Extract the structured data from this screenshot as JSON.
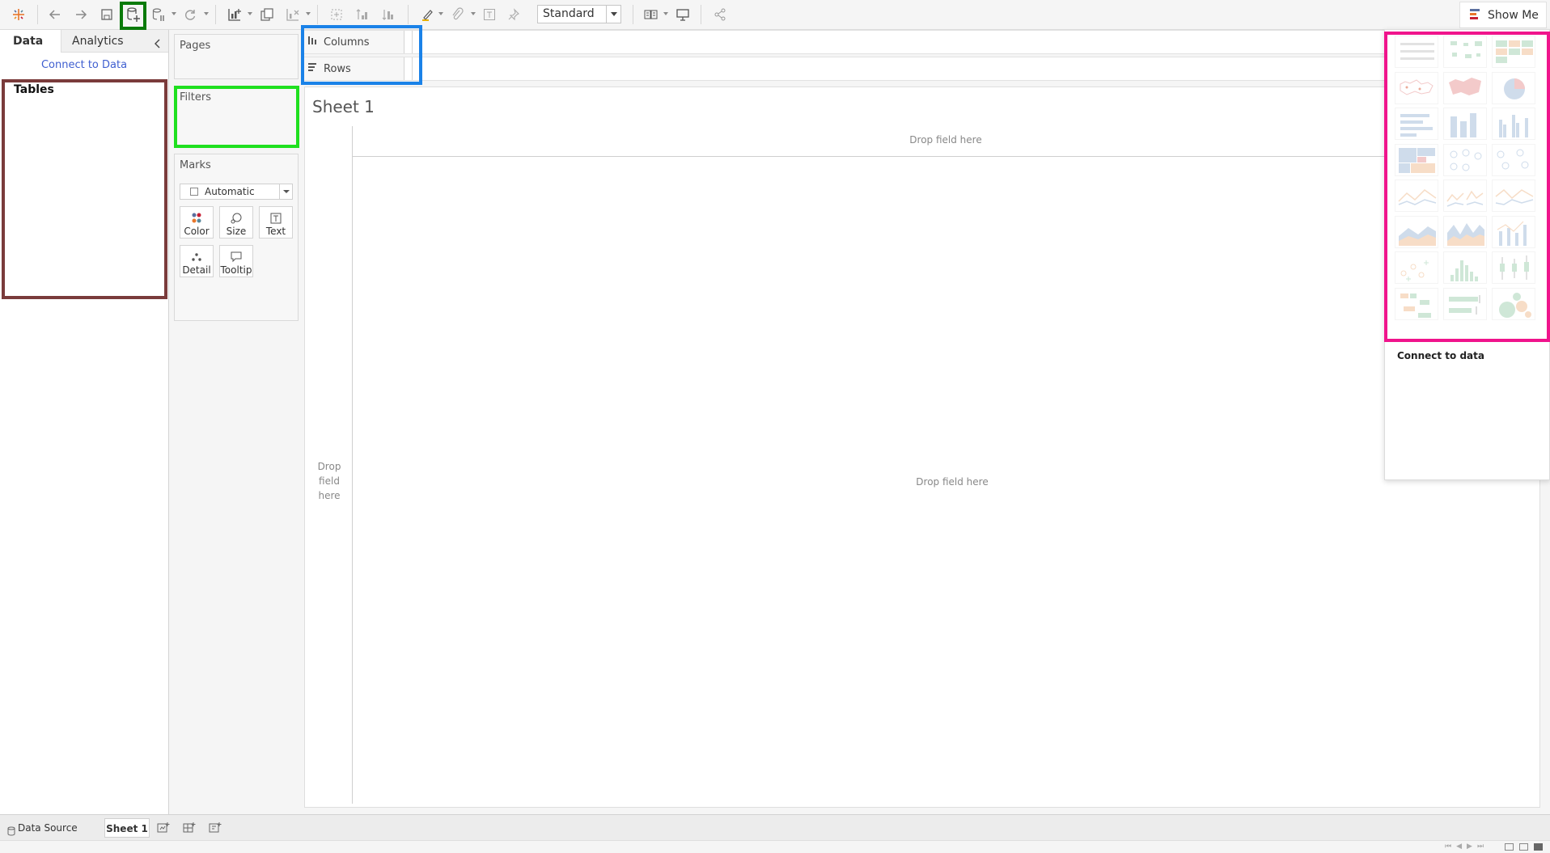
{
  "toolbar": {
    "view_mode": "Standard",
    "show_me_label": "Show Me"
  },
  "data_pane": {
    "tab_data": "Data",
    "tab_analytics": "Analytics",
    "connect_link": "Connect to Data",
    "tables_title": "Tables"
  },
  "shelves": {
    "pages": "Pages",
    "filters": "Filters",
    "marks": "Marks",
    "marks_type": "Automatic",
    "mark_buttons": [
      "Color",
      "Size",
      "Text",
      "Detail",
      "Tooltip"
    ],
    "columns": "Columns",
    "rows": "Rows"
  },
  "worksheet": {
    "title": "Sheet 1",
    "columns_drop": "Drop field here",
    "rows_drop": "Drop field here",
    "center_drop": "Drop field here"
  },
  "show_me": {
    "caption": "Connect to data",
    "chart_types": [
      "text-table",
      "heat-map",
      "highlight-table",
      "symbol-map",
      "filled-map",
      "pie-chart",
      "horizontal-bars",
      "stacked-bars",
      "side-by-side-bars",
      "treemap",
      "circle-view",
      "side-by-side-circles",
      "lines-continuous",
      "lines-discrete",
      "dual-lines",
      "area-continuous",
      "area-discrete",
      "dual-combination",
      "scatter-plot",
      "histogram",
      "box-and-whisker",
      "gantt-chart",
      "bullet-graph",
      "packed-bubbles"
    ]
  },
  "sheet_tabs": {
    "data_source": "Data Source",
    "sheet1": "Sheet 1"
  },
  "colors": {
    "highlight_toolbar_button": "#0a7a0a",
    "highlight_tables": "#7a3b3b",
    "highlight_filters": "#1fe01f",
    "highlight_columns_rows": "#1a82e8",
    "highlight_show_me": "#f0148c"
  }
}
